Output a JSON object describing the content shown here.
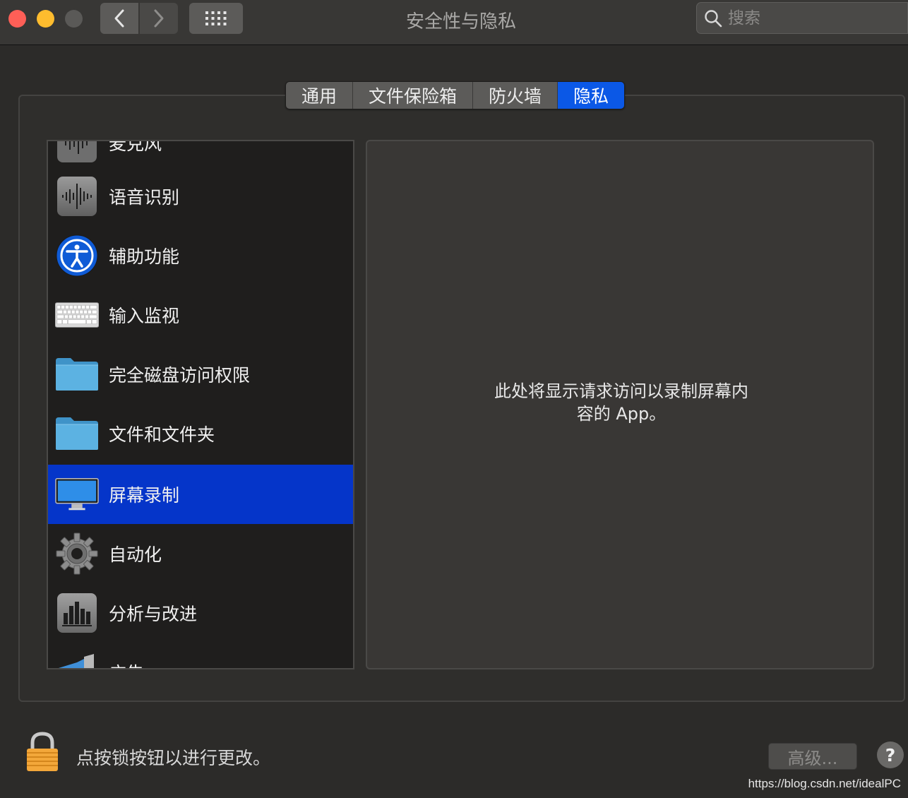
{
  "window": {
    "title": "安全性与隐私"
  },
  "search": {
    "placeholder": "搜索"
  },
  "tabs": [
    {
      "label": "通用",
      "active": false
    },
    {
      "label": "文件保险箱",
      "active": false
    },
    {
      "label": "防火墙",
      "active": false
    },
    {
      "label": "隐私",
      "active": true
    }
  ],
  "list": {
    "items": [
      {
        "label": "麦克风",
        "icon": "microphone-waveform-icon",
        "partial": true
      },
      {
        "label": "语音识别",
        "icon": "speech-waveform-icon"
      },
      {
        "label": "辅助功能",
        "icon": "accessibility-icon"
      },
      {
        "label": "输入监视",
        "icon": "keyboard-icon"
      },
      {
        "label": "完全磁盘访问权限",
        "icon": "folder-icon"
      },
      {
        "label": "文件和文件夹",
        "icon": "folder-icon"
      },
      {
        "label": "屏幕录制",
        "icon": "monitor-icon",
        "selected": true
      },
      {
        "label": "自动化",
        "icon": "gear-icon"
      },
      {
        "label": "分析与改进",
        "icon": "bar-chart-icon"
      },
      {
        "label": "广告",
        "icon": "megaphone-icon",
        "partial": true
      }
    ]
  },
  "detail": {
    "message_line1": "此处将显示请求访问以录制屏幕内",
    "message_line2": "容的 App。"
  },
  "footer": {
    "lock_text": "点按锁按钮以进行更改。",
    "advanced_label": "高级...",
    "help_label": "?",
    "watermark": "https://blog.csdn.net/idealPC"
  },
  "colors": {
    "accent": "#0b58e6",
    "selection": "#0535c9",
    "close": "#fe5f57",
    "minimize": "#febc2e"
  }
}
